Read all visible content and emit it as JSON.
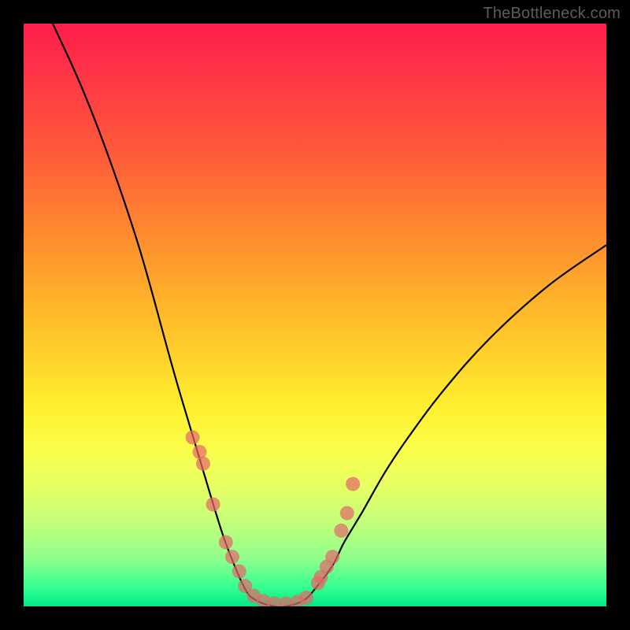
{
  "watermark": "TheBottleneck.com",
  "colors": {
    "frame": "#000000",
    "curve": "#000000",
    "marker": "#e36a6a",
    "gradient_top": "#ff1e4a",
    "gradient_bottom": "#00e884"
  },
  "chart_data": {
    "type": "line",
    "title": "",
    "xlabel": "",
    "ylabel": "",
    "xlim": [
      0,
      100
    ],
    "ylim": [
      0,
      100
    ],
    "grid": false,
    "legend": false,
    "notes": "V-shaped bottleneck curve over red→green vertical gradient. Axes and ticks are not labeled in the source image; x/y are normalized 0–100. y is bottleneck percentage (0 at green bottom, 100 at red top). Curve reaches ~0 between x≈38 and x≈48. Marker points are clustered on both arms near the bottom.",
    "series": [
      {
        "name": "bottleneck-curve",
        "x": [
          5,
          10,
          15,
          20,
          25,
          27,
          30,
          33,
          35,
          38,
          40,
          43,
          45,
          48,
          50,
          53,
          55,
          58,
          62,
          66,
          72,
          80,
          90,
          100
        ],
        "y": [
          100,
          89,
          76,
          61,
          43,
          36,
          26,
          16,
          10,
          3,
          1,
          0,
          0,
          1,
          3,
          7,
          11,
          16,
          23,
          29,
          37,
          46,
          55,
          62
        ]
      }
    ],
    "markers": {
      "name": "highlighted-points",
      "x": [
        29.0,
        30.2,
        30.8,
        32.5,
        34.7,
        35.8,
        37.0,
        38.0,
        39.5,
        41.2,
        43.0,
        45.0,
        47.0,
        48.5,
        50.5,
        51.0,
        52.0,
        53.0,
        54.5,
        55.5,
        56.5
      ],
      "y": [
        29.0,
        26.5,
        24.5,
        17.5,
        11.0,
        8.5,
        6.0,
        3.5,
        1.8,
        0.9,
        0.5,
        0.5,
        0.8,
        1.5,
        4.0,
        5.0,
        6.8,
        8.5,
        13.0,
        16.0,
        21.0
      ]
    }
  }
}
